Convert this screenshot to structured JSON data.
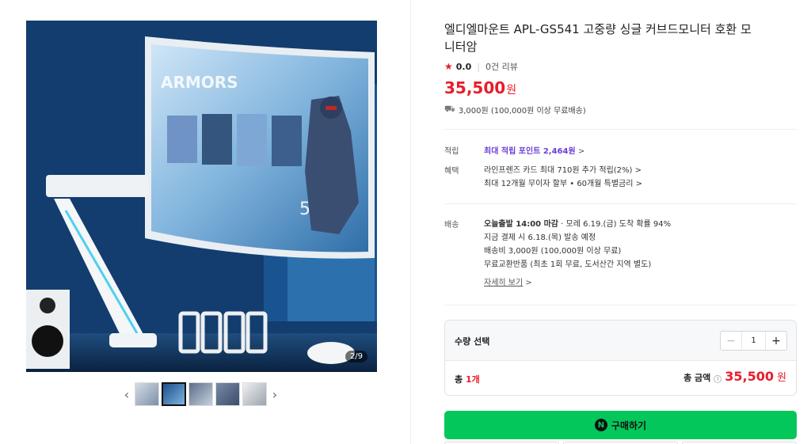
{
  "product": {
    "title": "엘디엘마운트 APL-GS541 고중량 싱글 커브드모니터 호환 모니터암",
    "rating": "0.0",
    "review_count": "0건 리뷰",
    "price": "35,500",
    "price_unit": "원",
    "shipping_summary": "3,000원 (100,000원 이상 무료배송)"
  },
  "gallery": {
    "counter": "2/9",
    "thumbnails": 5,
    "active_thumbnail": 2
  },
  "points": {
    "label": "적립",
    "text": "최대 적립 포인트 2,464원",
    "arrow": ">"
  },
  "benefits": {
    "label": "혜택",
    "line1": "라인프렌즈 카드 최대 710원 추가 적립(2%) >",
    "line2": "최대 12개월 무이자 할부 • 60개월 특별금리 >"
  },
  "delivery": {
    "label": "배송",
    "today_bold": "오늘출발 14:00 마감",
    "today_rest": " · 모레 6.19.(금) 도착 확률 94%",
    "line2": "지금 결제 시 6.18.(목) 발송 예정",
    "line3": "배송비 3,000원 (100,000원 이상 무료)",
    "line4": "무료교환반품 (최초 1회 무료, 도서산간 지역 별도)",
    "details_link": "자세히 보기",
    "details_arrow": ">"
  },
  "quantity": {
    "label": "수량 선택",
    "value": "1",
    "minus": "−",
    "plus": "+",
    "total_prefix": "총 ",
    "total_count": "1개",
    "total_label": "총 금액",
    "info_icon": "i",
    "total_amount": "35,500",
    "total_unit": "원"
  },
  "buy": {
    "icon_letter": "N",
    "label": "구매하기"
  },
  "colors": {
    "price_red": "#e81d2b",
    "buy_green": "#03c75a",
    "points_purple": "#6b3fd4"
  }
}
